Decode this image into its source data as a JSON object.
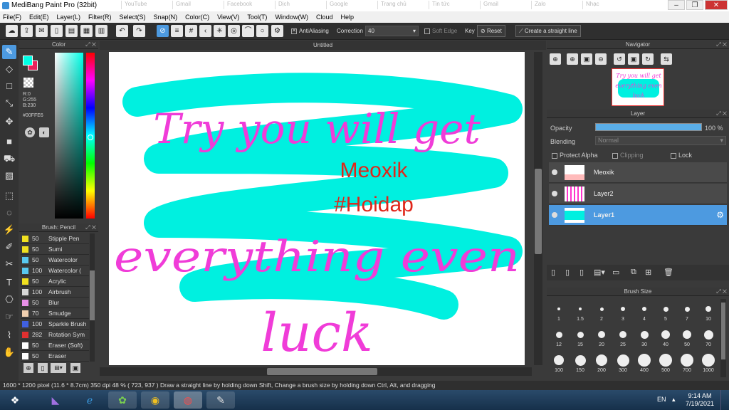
{
  "window": {
    "title": "MediBang Paint Pro (32bit)",
    "controls": [
      "–",
      "❐",
      "✕"
    ]
  },
  "ghost_tabs": [
    "YouTube",
    "Gmail",
    "Facebook",
    "Dịch",
    "Google",
    "Trang chủ",
    "Tin tức",
    "Gmail",
    "Zalo",
    "Nhạc"
  ],
  "menu": [
    "File(F)",
    "Edit(E)",
    "Layer(L)",
    "Filter(R)",
    "Select(S)",
    "Snap(N)",
    "Color(C)",
    "View(V)",
    "Tool(T)",
    "Window(W)",
    "Cloud",
    "Help"
  ],
  "toolbar": {
    "antialiasing_label": "AntiAliasing",
    "correction_label": "Correction",
    "correction_value": "40",
    "soft_edge_label": "Soft Edge",
    "key_label": "Key",
    "reset_label": "Reset",
    "straight_line_label": "Create a straight line"
  },
  "color_panel": {
    "title": "Color",
    "r": "R:0",
    "g": "G:255",
    "b": "B:230",
    "hex": "#00FFE6",
    "foreground": "#00FFE6",
    "background": "#E8205A"
  },
  "brush_panel": {
    "title": "Brush: Pencil",
    "brushes": [
      {
        "size": "50",
        "name": "Stipple Pen",
        "color": "#f0e020"
      },
      {
        "size": "50",
        "name": "Sumi",
        "color": "#f0e020"
      },
      {
        "size": "50",
        "name": "Watercolor",
        "color": "#58c8f0"
      },
      {
        "size": "100",
        "name": "Watercolor (",
        "color": "#58c8f0"
      },
      {
        "size": "50",
        "name": "Acrylic",
        "color": "#f0e020"
      },
      {
        "size": "100",
        "name": "Airbrush",
        "color": "#d8d8d8"
      },
      {
        "size": "50",
        "name": "Blur",
        "color": "#e890e8"
      },
      {
        "size": "70",
        "name": "Smudge",
        "color": "#f0d0b0"
      },
      {
        "size": "100",
        "name": "Sparkle Brush",
        "color": "#4060e0"
      },
      {
        "size": "282",
        "name": "Rotation Sym",
        "color": "#e03030"
      },
      {
        "size": "50",
        "name": "Eraser (Soft)",
        "color": "#ffffff"
      },
      {
        "size": "50",
        "name": "Eraser",
        "color": "#ffffff"
      }
    ]
  },
  "document": {
    "tab_title": "Untitled",
    "line1": "Try you will get",
    "line2": "everything even",
    "line3": "luck",
    "tag1": "Meoxik",
    "tag2": "#Hoidap",
    "pink": "#f03cd8",
    "cyan": "#00f0e0",
    "red": "#e0261a"
  },
  "navigator": {
    "title": "Navigator"
  },
  "layer_panel": {
    "title": "Layer",
    "opacity_label": "Opacity",
    "opacity_value": "100 %",
    "blending_label": "Blending",
    "blending_value": "Normal",
    "protect_alpha": "Protect Alpha",
    "clipping": "Clipping",
    "lock": "Lock",
    "layers": [
      {
        "name": "Meoxik",
        "selected": false
      },
      {
        "name": "Layer2",
        "selected": false
      },
      {
        "name": "Layer1",
        "selected": true
      }
    ]
  },
  "brush_size_panel": {
    "title": "Brush Size",
    "sizes": [
      "1",
      "1.5",
      "2",
      "3",
      "4",
      "5",
      "7",
      "10",
      "12",
      "15",
      "20",
      "25",
      "30",
      "40",
      "50",
      "70",
      "100",
      "150",
      "200",
      "300",
      "400",
      "500",
      "700",
      "1000"
    ]
  },
  "status": {
    "text": "1600 * 1200 pixel   (11.6 * 8.7cm)   350 dpi   48 %   ( 723, 937 )   Draw a straight line by holding down Shift, Change a brush size by holding down Ctrl, Alt, and dragging"
  },
  "taskbar": {
    "language": "EN",
    "time": "9:14 AM",
    "date": "7/19/2021"
  }
}
